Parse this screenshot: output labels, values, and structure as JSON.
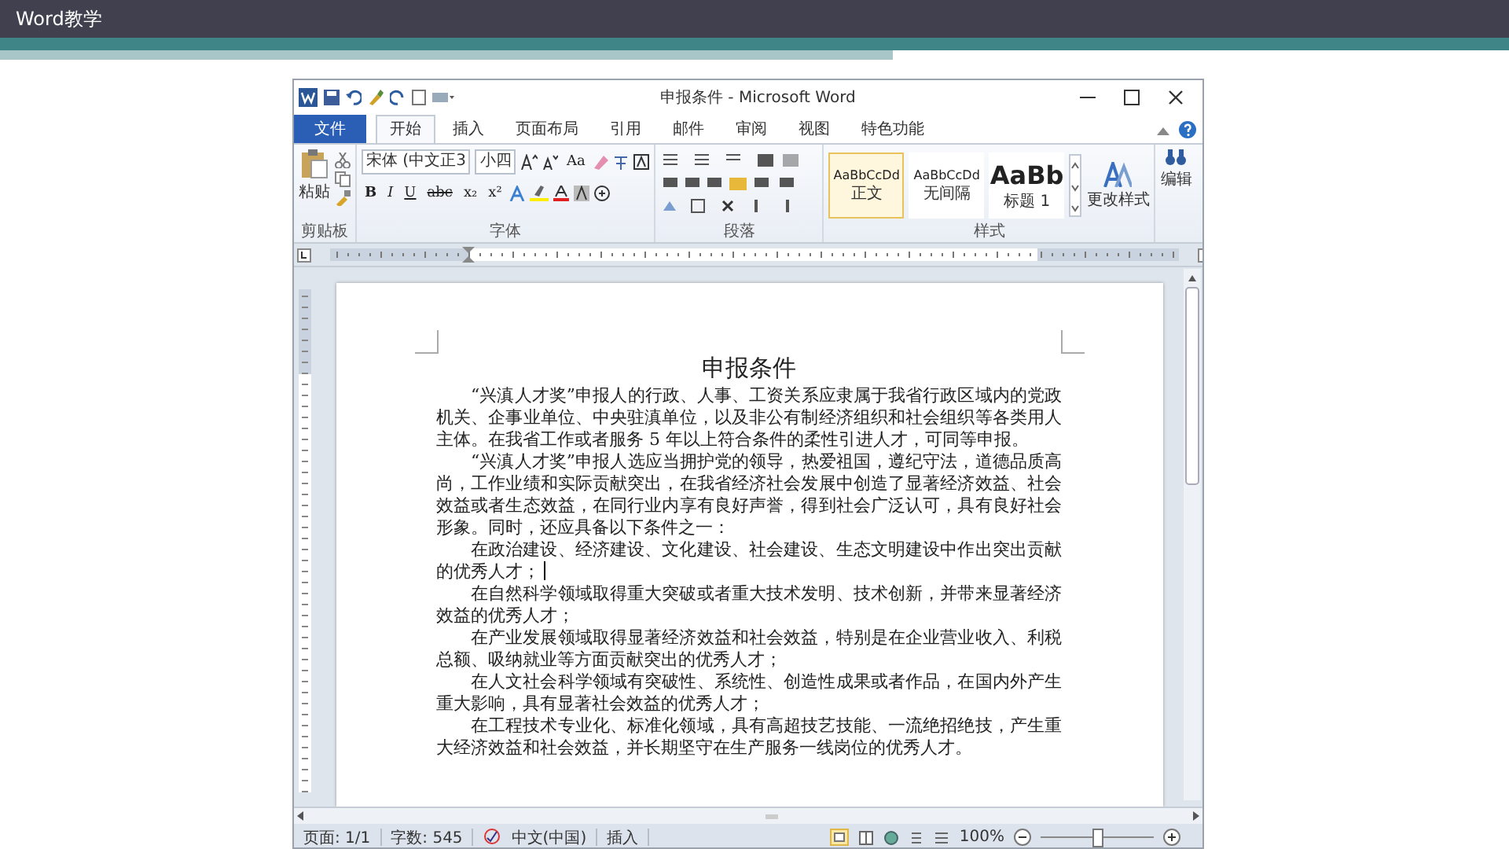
{
  "slide": {
    "title": "Word教学"
  },
  "window": {
    "title": "申报条件 - Microsoft Word"
  },
  "tabs": [
    {
      "label": "文件",
      "kind": "file",
      "selected": false
    },
    {
      "label": "开始",
      "kind": "tab",
      "selected": true
    },
    {
      "label": "插入",
      "kind": "tab",
      "selected": false
    },
    {
      "label": "页面布局",
      "kind": "tab",
      "selected": false
    },
    {
      "label": "引用",
      "kind": "tab",
      "selected": false
    },
    {
      "label": "邮件",
      "kind": "tab",
      "selected": false
    },
    {
      "label": "审阅",
      "kind": "tab",
      "selected": false
    },
    {
      "label": "视图",
      "kind": "tab",
      "selected": false
    },
    {
      "label": "特色功能",
      "kind": "tab",
      "selected": false
    }
  ],
  "ribbon": {
    "clipboard": {
      "paste": "粘贴",
      "group": "剪贴板"
    },
    "font": {
      "name": "宋体 (中文正3",
      "size": "小四",
      "case_button": "Aa",
      "format_buttons": [
        "B",
        "I",
        "U",
        "abc",
        "x₂",
        "x²"
      ],
      "group": "字体"
    },
    "paragraph": {
      "group": "段落"
    },
    "styles": {
      "items": [
        {
          "preview": "AaBbCcDd",
          "label": "正文",
          "kind": "normal",
          "selected": true
        },
        {
          "preview": "AaBbCcDd",
          "label": "无间隔",
          "kind": "normal",
          "selected": false
        },
        {
          "preview": "AaBb",
          "label": "标题 1",
          "kind": "heading",
          "selected": false
        }
      ],
      "change": "更改样式",
      "group": "样式"
    },
    "editing": {
      "label": "编辑"
    }
  },
  "document": {
    "title": "申报条件",
    "paragraphs": [
      {
        "text": "“兴滇人才奖”申报人的行政、人事、工资关系应隶属于我省行政区域内的党政机关、企事业单位、中央驻滇单位，以及非公有制经济组织和社会组织等各类用人主体。在我省工作或者服务 5 年以上符合条件的柔性引进人才，可同等申报。",
        "cursor": false
      },
      {
        "text": "“兴滇人才奖”申报人选应当拥护党的领导，热爱祖国，遵纪守法，道德品质高尚，工作业绩和实际贡献突出，在我省经济社会发展中创造了显著经济效益、社会效益或者生态效益，在同行业内享有良好声誉，得到社会广泛认可，具有良好社会形象。同时，还应具备以下条件之一：",
        "cursor": false
      },
      {
        "text": "在政治建设、经济建设、文化建设、社会建设、生态文明建设中作出突出贡献的优秀人才；",
        "cursor": true
      },
      {
        "text": "在自然科学领域取得重大突破或者重大技术发明、技术创新，并带来显著经济效益的优秀人才；",
        "cursor": false
      },
      {
        "text": "在产业发展领域取得显著经济效益和社会效益，特别是在企业营业收入、利税总额、吸纳就业等方面贡献突出的优秀人才；",
        "cursor": false
      },
      {
        "text": "在人文社会科学领域有突破性、系统性、创造性成果或者作品，在国内外产生重大影响，具有显著社会效益的优秀人才；",
        "cursor": false
      },
      {
        "text": "在工程技术专业化、标准化领域，具有高超技艺技能、一流绝招绝技，产生重大经济效益和社会效益，并长期坚守在生产服务一线岗位的优秀人才。",
        "cursor": false
      }
    ]
  },
  "status_bar": {
    "page": "页面: 1/1",
    "words": "字数: 545",
    "language": "中文(中国)",
    "mode": "插入",
    "zoom": "100%",
    "zoom_slider": {
      "level": 0.5
    }
  }
}
